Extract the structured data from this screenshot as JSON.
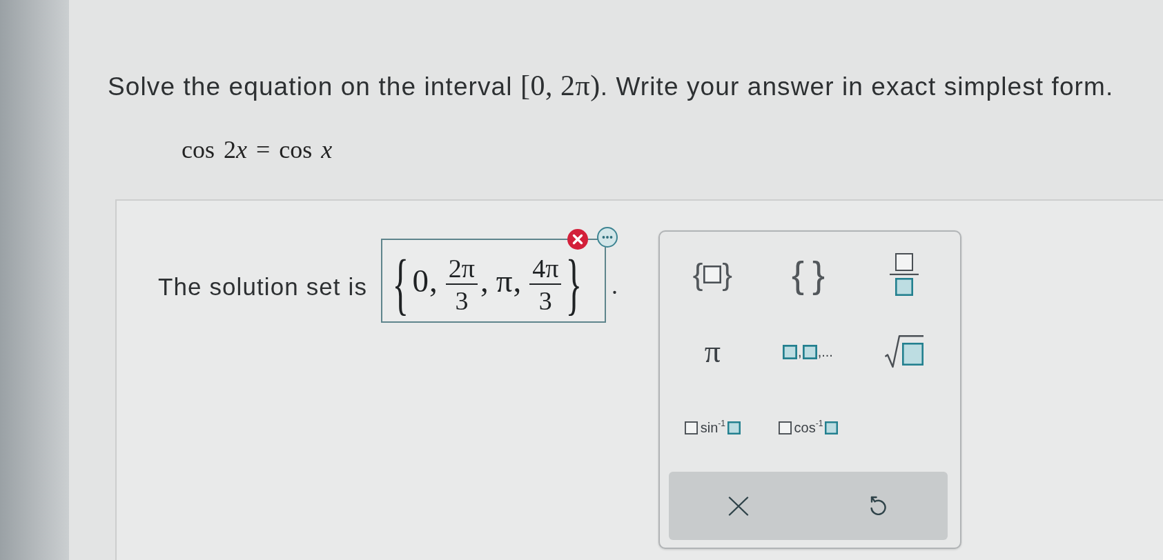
{
  "question": {
    "prompt": [
      {
        "kind": "text",
        "text": "Solve the equation on the interval "
      },
      {
        "kind": "math",
        "text": "[0, 2π)"
      },
      {
        "kind": "text",
        "text": ". Write your answer in exact simplest form."
      }
    ],
    "equation": [
      {
        "kind": "text",
        "text": "cos 2"
      },
      {
        "kind": "var",
        "text": "x"
      },
      {
        "kind": "text",
        "text": " = cos "
      },
      {
        "kind": "var",
        "text": "x"
      }
    ]
  },
  "answer": {
    "label": "The solution set is",
    "correct": false,
    "open": "{",
    "close": "}",
    "separator": ",",
    "items": [
      {
        "kind": "plain",
        "text": "0"
      },
      {
        "kind": "fraction",
        "numerator": "2π",
        "denominator": "3"
      },
      {
        "kind": "plain",
        "text": "π"
      },
      {
        "kind": "fraction",
        "numerator": "4π",
        "denominator": "3"
      }
    ],
    "end_mark": "."
  },
  "keypad": {
    "keys": [
      {
        "kind": "set",
        "open": "{",
        "close": "}"
      },
      {
        "kind": "braces",
        "open": "{",
        "close": "}"
      },
      {
        "kind": "fraction"
      },
      {
        "kind": "pi",
        "text": "π"
      },
      {
        "kind": "list",
        "separator": ",",
        "tail": ",..."
      },
      {
        "kind": "sqrt"
      },
      {
        "kind": "inverse",
        "function": "sin",
        "exponent": "-1"
      },
      {
        "kind": "inverse",
        "function": "cos",
        "exponent": "-1"
      }
    ],
    "actions": [
      {
        "kind": "clear"
      },
      {
        "kind": "undo"
      }
    ]
  }
}
